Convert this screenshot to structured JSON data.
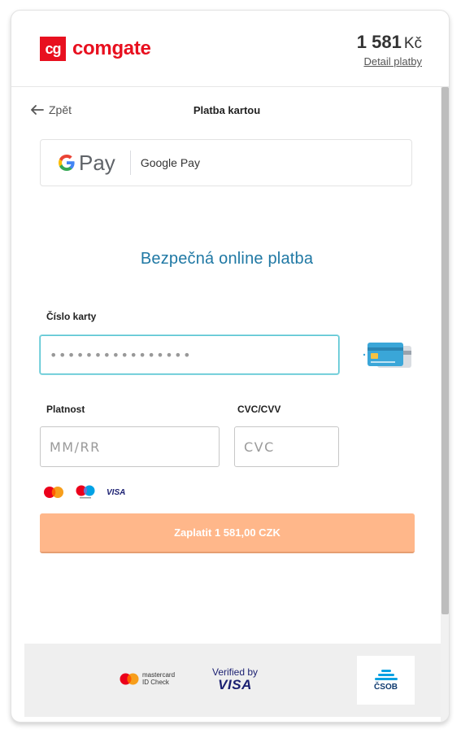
{
  "header": {
    "logo_mark": "cg",
    "logo_text": "comgate",
    "amount": "1 581",
    "currency": "Kč",
    "detail_link": "Detail platby"
  },
  "nav": {
    "back_label": "Zpět",
    "page_title": "Platba kartou"
  },
  "google_pay": {
    "label": "Google Pay",
    "logo_text": "Pay"
  },
  "form": {
    "title": "Bezpečná online platba",
    "card_number_label": "Číslo karty",
    "card_number_value": "••••••••••••••••",
    "expiry_label": "Platnost",
    "expiry_placeholder": "MM/RR",
    "cvc_label": "CVC/CVV",
    "cvc_placeholder": "CVC",
    "pay_button": "Zaplatit 1 581,00 CZK"
  },
  "brands": [
    "mastercard-icon",
    "maestro-icon",
    "visa-icon"
  ],
  "brand_labels": {
    "visa": "VISA"
  },
  "footer": {
    "mc_line1": "mastercard",
    "mc_line2": "ID Check",
    "verified_line1": "Verified by",
    "verified_line2": "VISA",
    "bank": "ČSOB"
  },
  "colors": {
    "brand": "#e8101f",
    "title": "#1f78a4",
    "pay_button": "#ffb78a",
    "input_focus": "#5bc6d3"
  }
}
